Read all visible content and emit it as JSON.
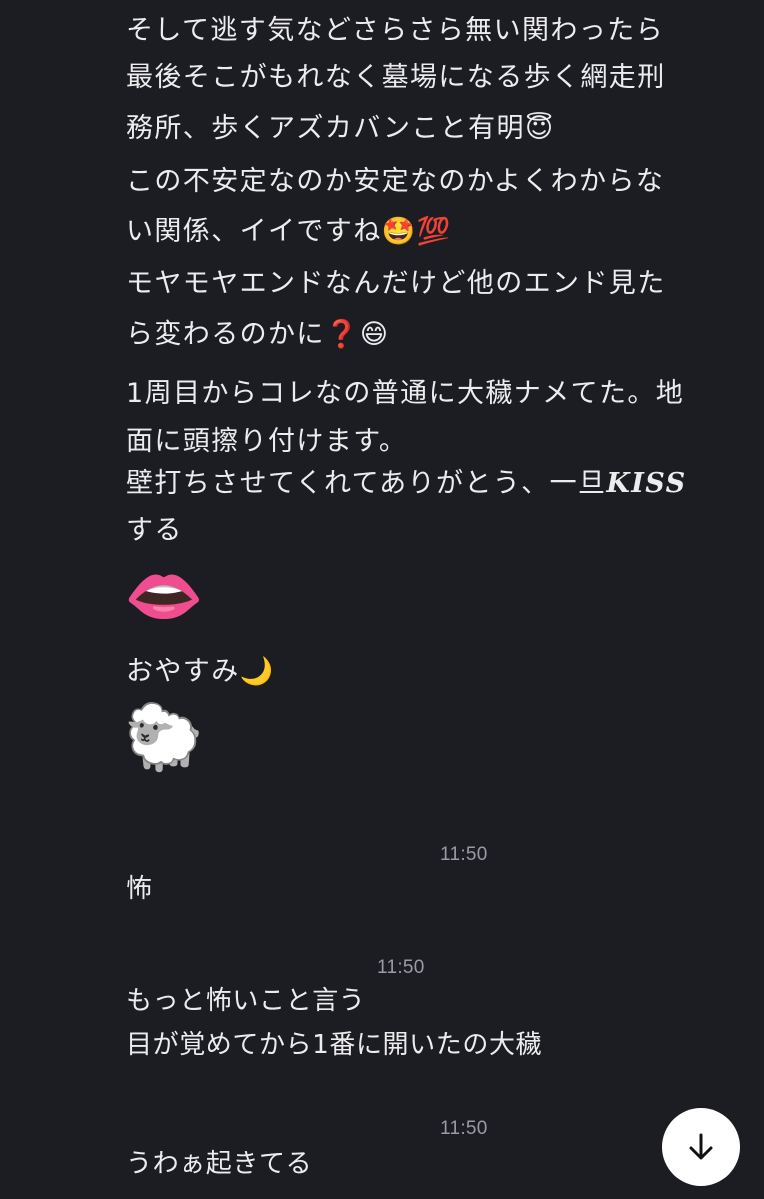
{
  "messages": [
    {
      "lines": [
        "そして逃す気などさらさら無い関わったら",
        "最後そこがもれなく墓場になる歩く網走刑",
        "務所、歩くアズカバンこと有明😇",
        "この不安定なのか安定なのかよくわからな",
        "い関係、イイですね🤩💯",
        "モヤモヤエンドなんだけど他のエンド見た",
        "ら変わるのかに❓😄",
        "1周目からコレなの普通に大穢ナメてた。地",
        "面に頭擦り付けます。"
      ],
      "kiss_line_prefix": "壁打ちさせてくれてありがとう、一旦",
      "kiss_word": "KISS",
      "kiss_line_end": "する",
      "lips_emoji": "👄",
      "goodnight": "おやすみ🌙",
      "sheep_emoji": "🐑"
    }
  ],
  "reply1": {
    "time": "11:50",
    "text": "怖"
  },
  "reply2": {
    "time": "11:50",
    "lines": [
      "もっと怖いこと言う",
      "目が覚めてから1番に開いたの大穢"
    ]
  },
  "reply3": {
    "time": "11:50",
    "text": "うわぁ起きてる"
  },
  "scroll_button": {
    "icon": "arrow-down-icon"
  }
}
